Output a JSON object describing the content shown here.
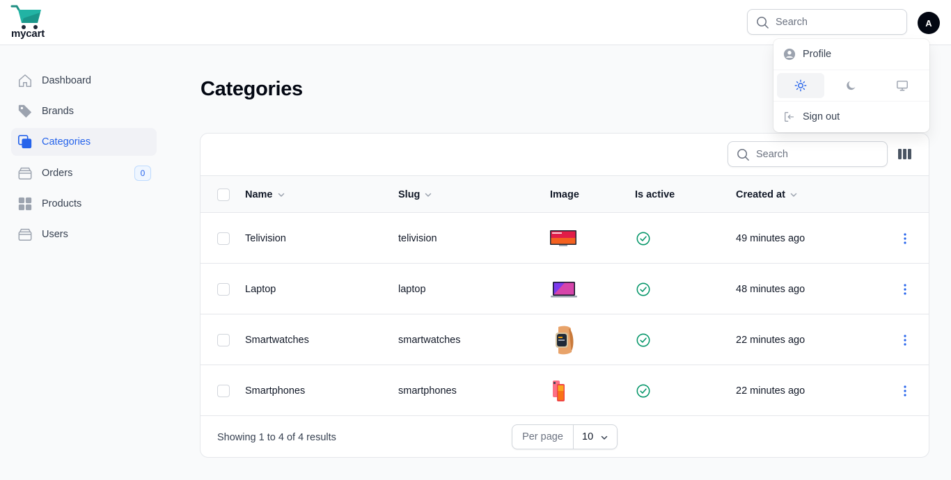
{
  "app": {
    "logo_text": "mycart",
    "avatar_initial": "A"
  },
  "colors": {
    "primary": "#2563eb",
    "success": "#059669",
    "logo_teal": "#22b3a4"
  },
  "topbar": {
    "search_placeholder": "Search"
  },
  "user_menu": {
    "profile_label": "Profile",
    "theme_options": [
      {
        "icon": "sun-icon",
        "active": true
      },
      {
        "icon": "moon-icon",
        "active": false
      },
      {
        "icon": "monitor-icon",
        "active": false
      }
    ],
    "signout_label": "Sign out"
  },
  "sidebar": {
    "items": [
      {
        "label": "Dashboard",
        "icon": "home-icon",
        "active": false
      },
      {
        "label": "Brands",
        "icon": "tag-icon",
        "active": false
      },
      {
        "label": "Categories",
        "icon": "squares-icon",
        "active": true
      },
      {
        "label": "Orders",
        "icon": "inbox-icon",
        "active": false,
        "badge": "0"
      },
      {
        "label": "Products",
        "icon": "grid-icon",
        "active": false
      },
      {
        "label": "Users",
        "icon": "inbox-icon",
        "active": false
      }
    ]
  },
  "page": {
    "title": "Categories"
  },
  "table": {
    "search_placeholder": "Search",
    "columns": {
      "name": "Name",
      "slug": "Slug",
      "image": "Image",
      "is_active": "Is active",
      "created_at": "Created at"
    },
    "rows": [
      {
        "name": "Telivision",
        "slug": "telivision",
        "image": "tv-thumbnail",
        "is_active": true,
        "created_at": "49 minutes ago"
      },
      {
        "name": "Laptop",
        "slug": "laptop",
        "image": "laptop-thumbnail",
        "is_active": true,
        "created_at": "48 minutes ago"
      },
      {
        "name": "Smartwatches",
        "slug": "smartwatches",
        "image": "watch-thumbnail",
        "is_active": true,
        "created_at": "22 minutes ago"
      },
      {
        "name": "Smartphones",
        "slug": "smartphones",
        "image": "phone-thumbnail",
        "is_active": true,
        "created_at": "22 minutes ago"
      }
    ],
    "footer": {
      "showing": "Showing 1 to 4 of 4 results",
      "per_page_label": "Per page",
      "per_page_value": "10"
    }
  }
}
